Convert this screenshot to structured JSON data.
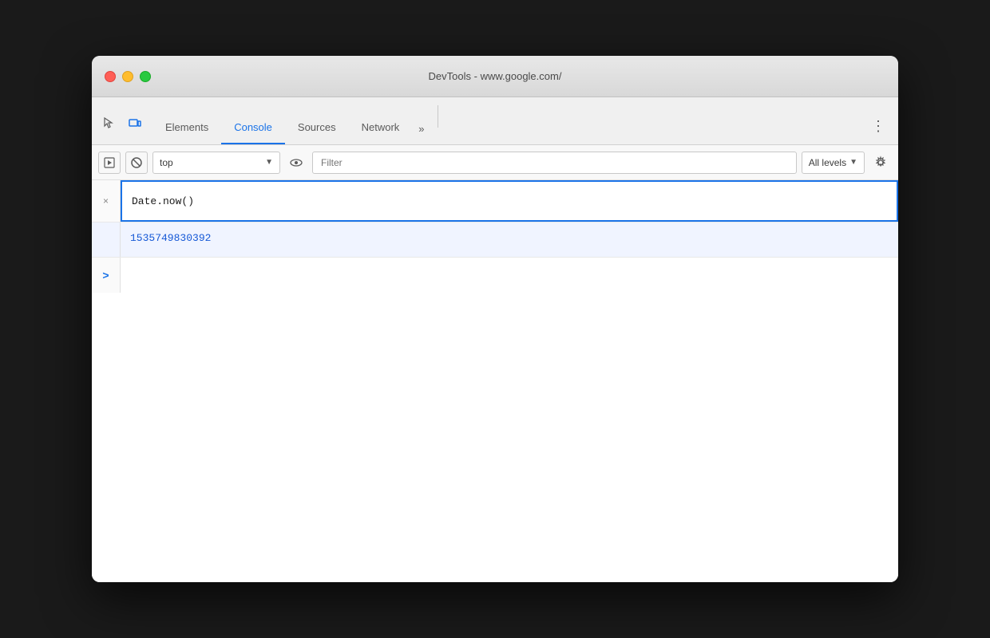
{
  "window": {
    "title": "DevTools - www.google.com/"
  },
  "tabs": {
    "items": [
      {
        "id": "elements",
        "label": "Elements",
        "active": false
      },
      {
        "id": "console",
        "label": "Console",
        "active": true
      },
      {
        "id": "sources",
        "label": "Sources",
        "active": false
      },
      {
        "id": "network",
        "label": "Network",
        "active": false
      }
    ],
    "more_label": "»",
    "menu_label": "⋮"
  },
  "toolbar": {
    "execute_label": "▶",
    "block_label": "🚫",
    "context_label": "top",
    "context_arrow": "▼",
    "filter_placeholder": "Filter",
    "levels_label": "All levels",
    "levels_arrow": "▼",
    "settings_label": "⚙"
  },
  "console": {
    "input_value": "Date.now()",
    "output_value": "1535749830392",
    "close_label": "×",
    "prompt_label": ">"
  }
}
